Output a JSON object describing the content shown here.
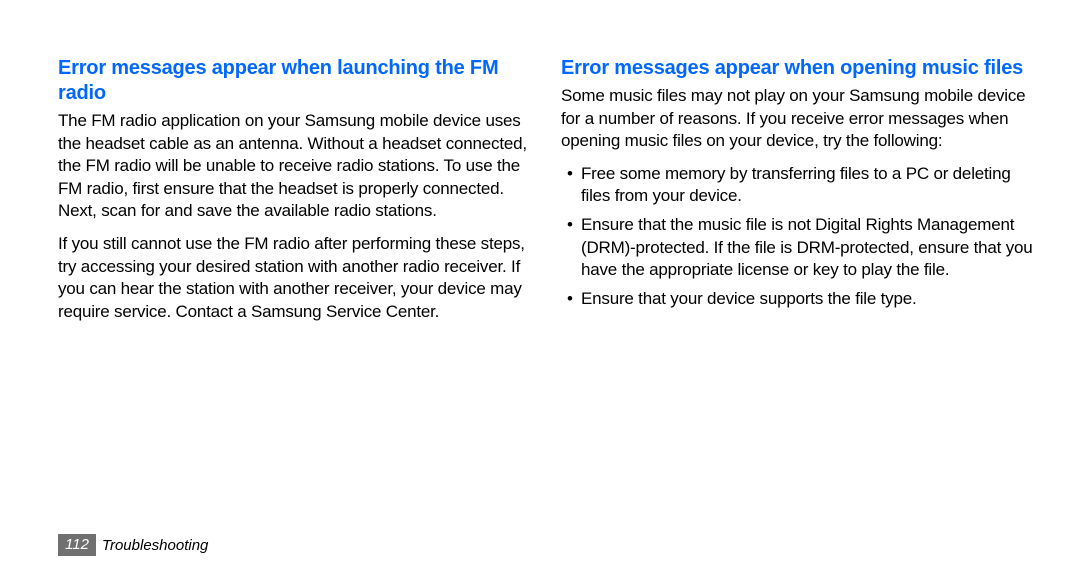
{
  "left": {
    "heading": "Error messages appear when launching the FM radio",
    "p1": "The FM radio application on your Samsung mobile device uses the headset cable as an antenna. Without a headset connected, the FM radio will be unable to receive radio stations. To use the FM radio, first ensure that the headset is properly connected. Next, scan for and save the available radio stations.",
    "p2": "If you still cannot use the FM radio after performing these steps, try accessing your desired station with another radio receiver. If you can hear the station with another receiver, your device may require service. Contact a Samsung Service Center."
  },
  "right": {
    "heading": "Error messages appear when opening music files",
    "intro": "Some music files may not play on your Samsung mobile device for a number of reasons. If you receive error messages when opening music files on your device, try the following:",
    "bullets": [
      "Free some memory by transferring files to a PC or deleting files from your device.",
      "Ensure that the music file is not Digital Rights Management (DRM)-protected. If the file is DRM-protected, ensure that you have the appropriate license or key to play the file.",
      "Ensure that your device supports the file type."
    ]
  },
  "footer": {
    "pageNumber": "112",
    "section": "Troubleshooting"
  }
}
